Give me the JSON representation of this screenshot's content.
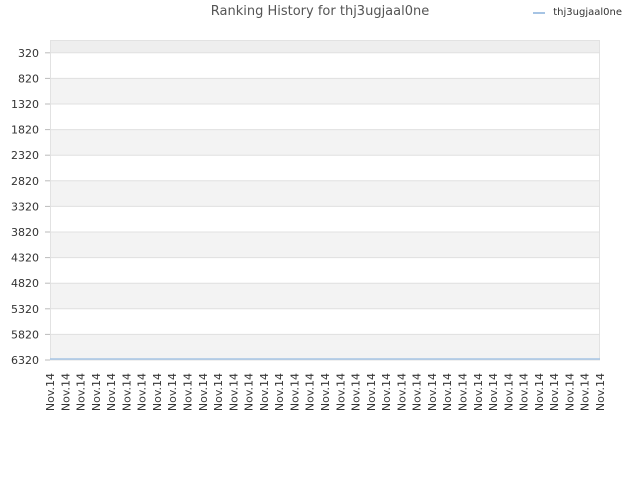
{
  "chart_data": {
    "type": "line",
    "title": "Ranking History for thj3ugjaal0ne",
    "xlabel": "",
    "ylabel": "",
    "y_inverted": true,
    "ylim": [
      6320,
      70
    ],
    "y_ticks": [
      "320",
      "820",
      "1320",
      "1820",
      "2320",
      "2820",
      "3320",
      "3820",
      "4320",
      "4820",
      "5320",
      "5820",
      "6320"
    ],
    "x_ticks": [
      "Nov.14",
      "Nov.14",
      "Nov.14",
      "Nov.14",
      "Nov.14",
      "Nov.14",
      "Nov.14",
      "Nov.14",
      "Nov.14",
      "Nov.14",
      "Nov.14",
      "Nov.14",
      "Nov.14",
      "Nov.14",
      "Nov.14",
      "Nov.14",
      "Nov.14",
      "Nov.14",
      "Nov.14",
      "Nov.14",
      "Nov.14",
      "Nov.14",
      "Nov.14",
      "Nov.14",
      "Nov.14",
      "Nov.14",
      "Nov.14",
      "Nov.14",
      "Nov.14",
      "Nov.14",
      "Nov.14",
      "Nov.14",
      "Nov.14",
      "Nov.14",
      "Nov.14",
      "Nov.14",
      "Nov.14"
    ],
    "legend_position": "top-right",
    "grid": true,
    "series": [
      {
        "name": "thj3ugjaal0ne",
        "color": "#a6c4e4",
        "values": [
          6320,
          6320,
          6320,
          6320,
          6320,
          6320,
          6320,
          6320,
          6320,
          6320,
          6320,
          6320,
          6320,
          6320,
          6320,
          6320,
          6320,
          6320,
          6320,
          6320,
          6320,
          6320,
          6320,
          6320,
          6320,
          6320,
          6320,
          6320,
          6320,
          6320,
          6320,
          6320,
          6320,
          6320,
          6320,
          6320,
          6320
        ]
      }
    ],
    "band_colors": [
      "#eeeeee",
      "#ffffff",
      "#f3f3f3"
    ]
  }
}
